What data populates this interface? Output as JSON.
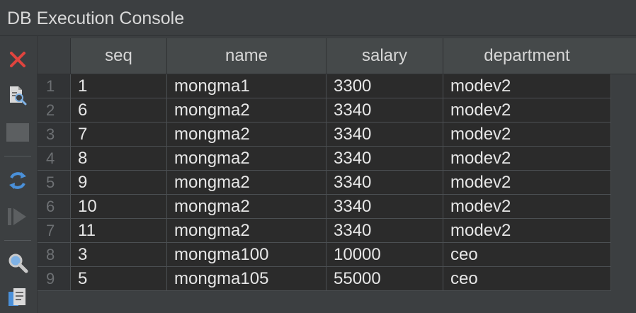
{
  "window": {
    "title": "DB Execution Console"
  },
  "toolbar": {
    "buttons": [
      {
        "name": "close-icon",
        "color": "#e0443e"
      },
      {
        "name": "query-inspect-icon",
        "color": "#c9c9c9"
      },
      {
        "name": "stop-icon",
        "color": "#5c5f61"
      },
      {
        "name": "rerun-icon",
        "color": "#4a90d9"
      },
      {
        "name": "run-icon",
        "color": "#5c5f61"
      },
      {
        "name": "search-icon",
        "color": "#c9c9c9"
      },
      {
        "name": "copy-icon",
        "color": "#c9c9c9"
      }
    ]
  },
  "table": {
    "columns": [
      "seq",
      "name",
      "salary",
      "department"
    ],
    "rows": [
      {
        "n": "1",
        "cells": [
          "1",
          "mongma1",
          "3300",
          "modev2"
        ]
      },
      {
        "n": "2",
        "cells": [
          "6",
          "mongma2",
          "3340",
          "modev2"
        ]
      },
      {
        "n": "3",
        "cells": [
          "7",
          "mongma2",
          "3340",
          "modev2"
        ]
      },
      {
        "n": "4",
        "cells": [
          "8",
          "mongma2",
          "3340",
          "modev2"
        ]
      },
      {
        "n": "5",
        "cells": [
          "9",
          "mongma2",
          "3340",
          "modev2"
        ]
      },
      {
        "n": "6",
        "cells": [
          "10",
          "mongma2",
          "3340",
          "modev2"
        ]
      },
      {
        "n": "7",
        "cells": [
          "11",
          "mongma2",
          "3340",
          "modev2"
        ]
      },
      {
        "n": "8",
        "cells": [
          "3",
          "mongma100",
          "10000",
          "ceo"
        ]
      },
      {
        "n": "9",
        "cells": [
          "5",
          "mongma105",
          "55000",
          "ceo"
        ]
      }
    ]
  }
}
